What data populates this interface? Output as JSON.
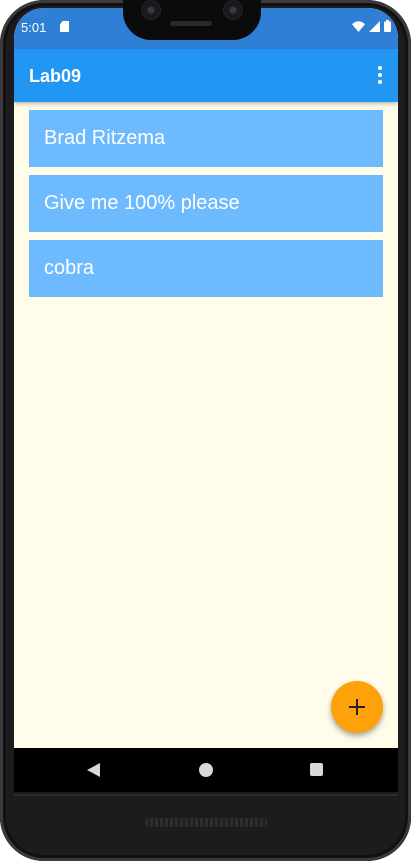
{
  "status_bar": {
    "time": "5:01",
    "left_icons": [
      "sd-card-icon"
    ],
    "right_icons": [
      "wifi-icon",
      "cell-signal-icon",
      "battery-icon"
    ],
    "color": "#2f7fd6"
  },
  "app_bar": {
    "title": "Lab09",
    "menu_icon": "more-vert-icon",
    "color": "#2196f3"
  },
  "list": {
    "items": [
      {
        "label": "Brad Ritzema"
      },
      {
        "label": "Give me 100% please"
      },
      {
        "label": "cobra"
      }
    ],
    "item_color": "#6ebaff"
  },
  "fab": {
    "icon": "plus-icon",
    "color": "#ffa10a"
  },
  "nav_bar": {
    "buttons": [
      "back-icon",
      "home-icon",
      "recents-icon"
    ]
  },
  "colors": {
    "background": "#fffde9"
  }
}
